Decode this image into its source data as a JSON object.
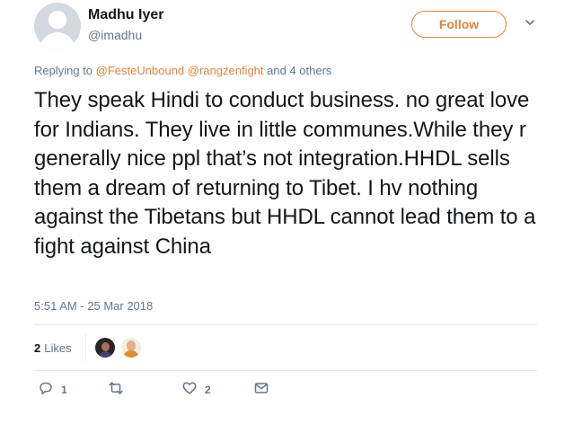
{
  "user": {
    "display_name": "Madhu Iyer",
    "handle": "@imadhu"
  },
  "follow_button": {
    "label": "Follow"
  },
  "reply_context": {
    "prefix": "Replying to",
    "mentions": [
      "@FesteUnbound",
      "@rangzenfight"
    ],
    "suffix": "and 4 others"
  },
  "tweet": {
    "text": "They speak Hindi to conduct business. no great love for Indians. They live in little communes.While they r generally nice ppl that’s not integration.HHDL sells them a dream of returning to Tibet. I hv nothing against the Tibetans but HHDL cannot lead them to a fight against China",
    "timestamp": "5:51 AM - 25 Mar 2018"
  },
  "stats": {
    "likes_count": "2",
    "likes_label": "Likes"
  },
  "actions": {
    "reply_count": "1",
    "retweet_count": "",
    "like_count": "2"
  },
  "icons": {
    "avatar": "default-egg-avatar",
    "caret": "chevron-down-icon",
    "reply": "reply-icon",
    "retweet": "retweet-icon",
    "like": "heart-icon",
    "dm": "envelope-icon"
  },
  "colors": {
    "accent": "#e0833a",
    "text": "#14171a",
    "muted": "#657786",
    "divider": "#e6ecf0"
  }
}
